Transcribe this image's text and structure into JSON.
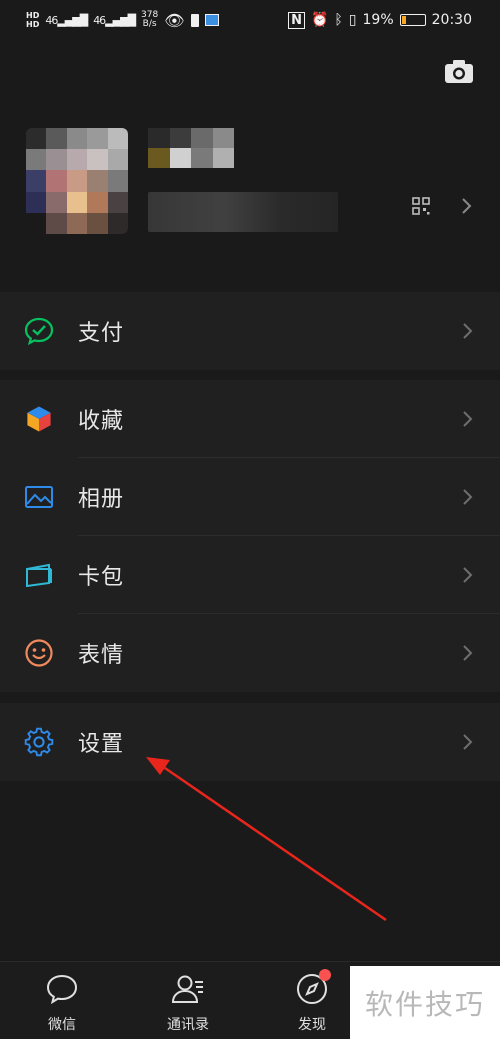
{
  "status_bar": {
    "network_top": "HD",
    "network_bottom": "HD",
    "signal1": "46",
    "signal2": "46",
    "speed_value": "378",
    "speed_unit": "B/s",
    "battery_percent": "19%",
    "time": "20:30",
    "battery_level": 0.19
  },
  "menu": {
    "pay": {
      "label": "支付",
      "icon": "wechat-pay-icon"
    },
    "favorites": {
      "label": "收藏",
      "icon": "cube-icon"
    },
    "album": {
      "label": "相册",
      "icon": "image-icon"
    },
    "cards": {
      "label": "卡包",
      "icon": "wallet-card-icon"
    },
    "stickers": {
      "label": "表情",
      "icon": "smiley-icon"
    },
    "settings": {
      "label": "设置",
      "icon": "gear-icon"
    }
  },
  "tabs": [
    {
      "label": "微信",
      "icon": "chat-bubble-icon"
    },
    {
      "label": "通讯录",
      "icon": "contacts-icon"
    },
    {
      "label": "发现",
      "icon": "compass-icon"
    }
  ],
  "watermark": "软件技巧",
  "colors": {
    "background": "#1a1a1a",
    "panel": "#202020",
    "pay_green": "#07c160",
    "accent_blue": "#2f8bea",
    "sticker_orange": "#f08a5d",
    "arrow_red": "#e8261c",
    "badge_red": "#fa5151"
  }
}
